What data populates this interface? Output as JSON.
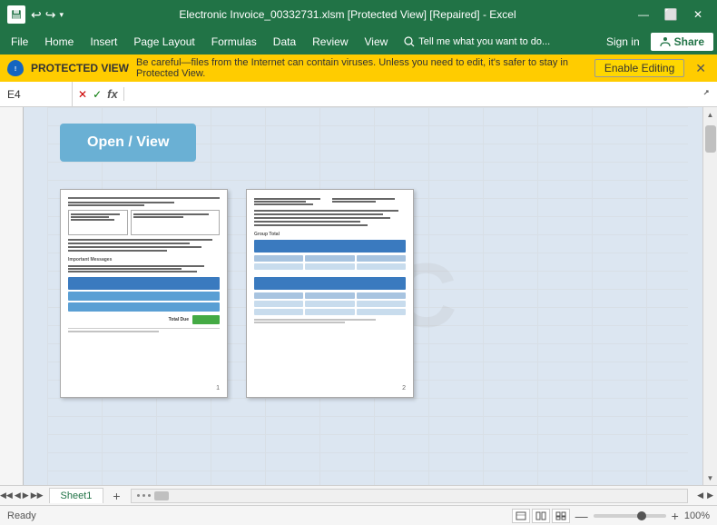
{
  "titleBar": {
    "title": "Electronic Invoice_00332731.xlsm  [Protected View] [Repaired] - Excel",
    "saveLabel": "💾",
    "undoLabel": "↩",
    "redoLabel": "↪",
    "minimizeLabel": "—",
    "maximizeLabel": "⬜",
    "closeLabel": "✕"
  },
  "menuBar": {
    "items": [
      "File",
      "Home",
      "Insert",
      "Page Layout",
      "Formulas",
      "Data",
      "Review",
      "View"
    ],
    "tellLabel": "🔍 Tell me what you want to do...",
    "signInLabel": "Sign in",
    "shareLabel": "Share",
    "shareIcon": "👤"
  },
  "protectedBar": {
    "label": "PROTECTED VIEW",
    "text": "Be careful—files from the Internet can contain viruses. Unless you need to edit, it's safer to stay in Protected View.",
    "enableEditingLabel": "Enable Editing",
    "closeLabel": "✕"
  },
  "formulaBar": {
    "cellRef": "E4",
    "cancelIcon": "✕",
    "confirmIcon": "✓",
    "fxIcon": "fx"
  },
  "sheet": {
    "openViewLabel": "Open / View",
    "content": {
      "watermark": "GTC"
    }
  },
  "sheetTabs": {
    "activeTab": "Sheet1",
    "addLabel": "+"
  },
  "statusBar": {
    "status": "Ready",
    "zoomLabel": "100%",
    "zoomMinus": "—",
    "zoomPlus": "+"
  }
}
